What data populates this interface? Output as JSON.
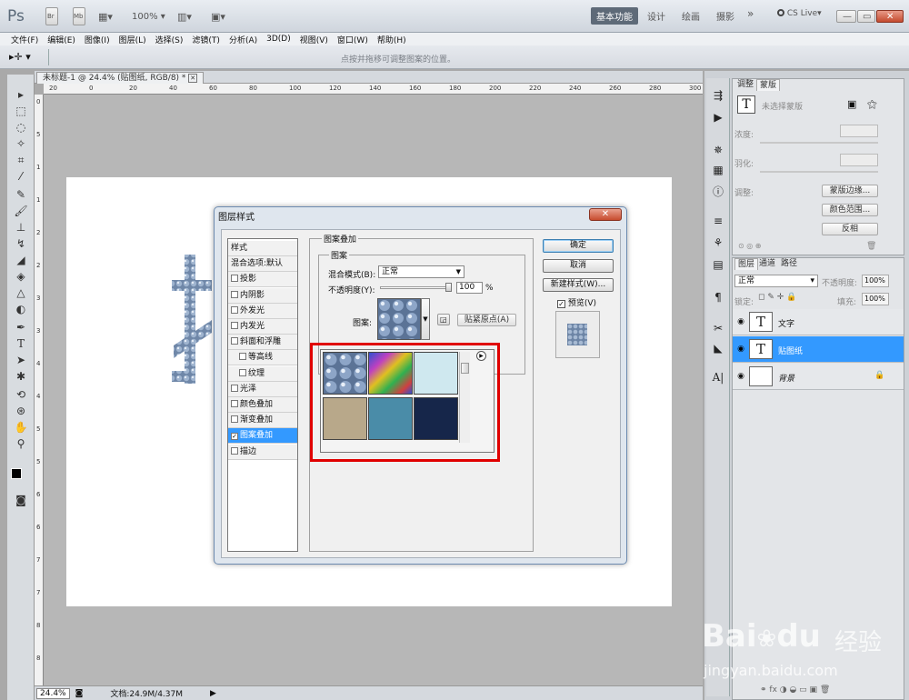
{
  "app": {
    "logo": "Ps",
    "zoom": "100%",
    "workspaces": [
      "基本功能",
      "设计",
      "绘画",
      "摄影"
    ],
    "more": "»",
    "cslive": "CS Live▾"
  },
  "menu": [
    "文件(F)",
    "编辑(E)",
    "图像(I)",
    "图层(L)",
    "选择(S)",
    "滤镜(T)",
    "分析(A)",
    "3D(D)",
    "视图(V)",
    "窗口(W)",
    "帮助(H)"
  ],
  "options": {
    "hint": "点按并拖移可调整图案的位置。"
  },
  "document": {
    "tab": "未标题-1 @ 24.4% (贴图纸, RGB/8) *",
    "ruler_h": [
      "20",
      "0",
      "20",
      "40",
      "60",
      "80",
      "100",
      "120",
      "140",
      "160",
      "180",
      "200",
      "220",
      "240",
      "260",
      "280",
      "300"
    ],
    "ruler_v": [
      "0",
      "5",
      "1",
      "1",
      "2",
      "2",
      "3",
      "3",
      "4",
      "4",
      "5",
      "5",
      "6",
      "6",
      "7",
      "7",
      "8",
      "8"
    ],
    "bigchar": "扌"
  },
  "status": {
    "zoom": "24.4%",
    "doc": "文档:24.9M/4.37M"
  },
  "adjust": {
    "tabs": [
      "调整",
      "蒙版"
    ],
    "title": "未选择蒙版",
    "density": "浓度:",
    "feather": "羽化:",
    "refine": "调整:",
    "btn_edge": "蒙版边缘...",
    "btn_range": "颜色范围...",
    "btn_invert": "反相"
  },
  "layers": {
    "tabs": [
      "图层",
      "通道",
      "路径"
    ],
    "blend": "正常",
    "opacity_label": "不透明度:",
    "opacity": "100%",
    "lock_label": "锁定:",
    "fill_label": "填充:",
    "fill": "100%",
    "items": [
      {
        "name": "文字",
        "thumb": "T",
        "selected": false
      },
      {
        "name": "贴图纸",
        "thumb": "T",
        "selected": true
      },
      {
        "name": "背景",
        "thumb": "",
        "selected": false
      }
    ]
  },
  "dialog": {
    "title": "图层样式",
    "close": "✕",
    "styles": [
      {
        "label": "样式",
        "type": "header"
      },
      {
        "label": "混合选项:默认",
        "type": "header"
      },
      {
        "label": "投影",
        "type": "cb",
        "checked": false
      },
      {
        "label": "内阴影",
        "type": "cb",
        "checked": false
      },
      {
        "label": "外发光",
        "type": "cb",
        "checked": false
      },
      {
        "label": "内发光",
        "type": "cb",
        "checked": false
      },
      {
        "label": "斜面和浮雕",
        "type": "cb",
        "checked": false
      },
      {
        "label": "等高线",
        "type": "sub",
        "checked": false
      },
      {
        "label": "纹理",
        "type": "sub",
        "checked": false
      },
      {
        "label": "光泽",
        "type": "cb",
        "checked": false
      },
      {
        "label": "颜色叠加",
        "type": "cb",
        "checked": false
      },
      {
        "label": "渐变叠加",
        "type": "cb",
        "checked": false
      },
      {
        "label": "图案叠加",
        "type": "cb",
        "checked": true,
        "selected": true
      },
      {
        "label": "描边",
        "type": "cb",
        "checked": false
      }
    ],
    "group_title": "图案叠加",
    "subgroup_title": "图案",
    "blend_label": "混合模式(B):",
    "blend_value": "正常",
    "opacity_label": "不透明度(Y):",
    "opacity_value": "100",
    "percent": "%",
    "pattern_label": "图案:",
    "snap_btn": "贴紧原点(A)",
    "ok": "确定",
    "cancel": "取消",
    "new_style": "新建样式(W)...",
    "preview": "预览(V)",
    "swatches": [
      "bubbles",
      "rainbow",
      "lightblue",
      "tan",
      "teal",
      "navy"
    ],
    "highlight_color": "#e00000"
  },
  "watermark": {
    "brand": "Bai",
    "brand2": "du",
    "cn": "经验",
    "url": "jingyan.baidu.com"
  }
}
